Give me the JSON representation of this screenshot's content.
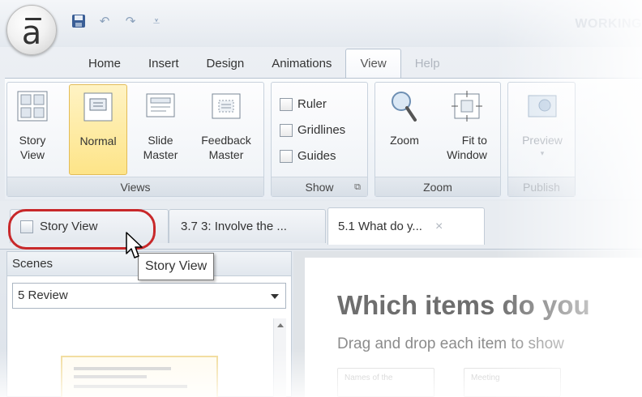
{
  "window": {
    "title": "WORKING"
  },
  "logo": {
    "letter": "a"
  },
  "quick_access": {
    "items": [
      "save-icon",
      "undo-icon",
      "redo-icon",
      "customize-icon"
    ]
  },
  "ribbon_tabs": [
    {
      "label": "Home",
      "active": false
    },
    {
      "label": "Insert",
      "active": false
    },
    {
      "label": "Design",
      "active": false
    },
    {
      "label": "Animations",
      "active": false
    },
    {
      "label": "View",
      "active": true
    },
    {
      "label": "Help",
      "active": false
    }
  ],
  "ribbon": {
    "views": {
      "label": "Views",
      "story_view": "Story\nView",
      "normal": "Normal",
      "slide_master": "Slide\nMaster",
      "feedback_master": "Feedback\nMaster"
    },
    "show": {
      "label": "Show",
      "ruler": "Ruler",
      "gridlines": "Gridlines",
      "guides": "Guides"
    },
    "zoom": {
      "label": "Zoom",
      "zoom": "Zoom",
      "fit_to_window": "Fit to\nWindow"
    },
    "publish": {
      "label": "Publish",
      "preview": "Preview"
    }
  },
  "document_tabs": [
    {
      "label": "Story View",
      "active": false
    },
    {
      "label": "3.7 3: Involve the ...",
      "active": false
    },
    {
      "label": "5.1 What do y...",
      "active": true,
      "close": "×"
    }
  ],
  "tooltip": {
    "text": "Story View"
  },
  "scenes": {
    "header": "Scenes",
    "selected": "5 Review"
  },
  "slide": {
    "title": "Which items do you",
    "subtitle": "Drag and drop each item to show",
    "box_1": "Names of the",
    "box_2": "Meeting"
  },
  "colors": {
    "highlight_ring": "#c8282a",
    "selected_button": "#fde488"
  }
}
